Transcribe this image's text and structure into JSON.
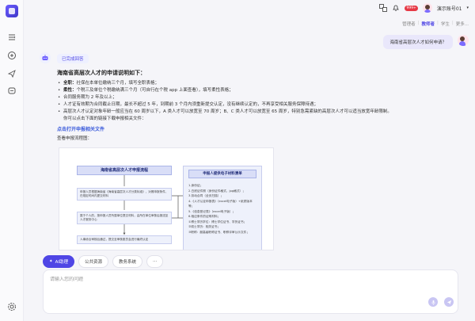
{
  "topbar": {
    "badge": "999+",
    "account": "演示账号01",
    "roles": [
      "管理者",
      "教师者",
      "学生",
      "更多..."
    ],
    "active_role_index": 1
  },
  "user_message": "海南省高层次人才如何申请？",
  "assistant": {
    "status": "已完成回答",
    "heading": "海南省高层次人才的申请说明如下：",
    "items": [
      {
        "bold": "全职：",
        "text": "社保在本单位缴纳三个月，填写全职表格；"
      },
      {
        "bold": "柔性：",
        "text": "个税三及单位个税缴纳满三个月（可自行在个税 app 上面查看），填写柔性表格；"
      },
      {
        "bold": "",
        "text": "合同服务期为 2 年及以上；"
      },
      {
        "bold": "",
        "text": "人才证有效期为合同截止日期，最长不超过 5 年，到期前 3 个月内须重新提交认定，没有继续认定的，不再享受相关服务保障待遇；"
      },
      {
        "bold": "",
        "text": "高层次人才认定对象年龄一般应当在 60 周岁以下，A 类人才可以放宽至 70 周岁；B、C 类人才可以放宽至 65 周岁，特别急需紧缺的高层次人才可以适当放宽年龄限制。"
      },
      {
        "bold": "",
        "text": "你可以点击下面的链接下载申报相关文件："
      }
    ],
    "link_title": "点击打开申报相关文件",
    "view_text": "查看申报流程图："
  },
  "flowchart": {
    "left_title": "海南省高层次人才申报流程",
    "steps": [
      "申报人员根据海南省《海南省高层次人才分类标准》，对照申报条件，在规定时间内提交材料",
      "属于个人的，按申报人员所属单位提交材料，由所在单位审核后报送至人才服务中心",
      "人事综合审核后通过，提交至审核委员会进行最终认定"
    ],
    "right_title": "申报人提供电子材料清单",
    "right_list": [
      "1.身份证；",
      "2.白底证件照（身份证件格式，jpg格式）；",
      "3.劳动合同（全页扫描）；",
      "4.《人才认定申报表》（excel电子版）+纸质版本等；",
      "5.《信息登记表》（excel电子版）；",
      "6.相应条件的证明材料；",
      "①博士学历学位：博士学位证书、学历证书；",
      "②硕士学历：相关证书；",
      "③职称：副高级职称证书、职称评审公示文件；"
    ]
  },
  "chips": [
    "AI助理",
    "公共资源",
    "教务系统",
    "···"
  ],
  "input": {
    "placeholder": "请输入您的问题"
  }
}
